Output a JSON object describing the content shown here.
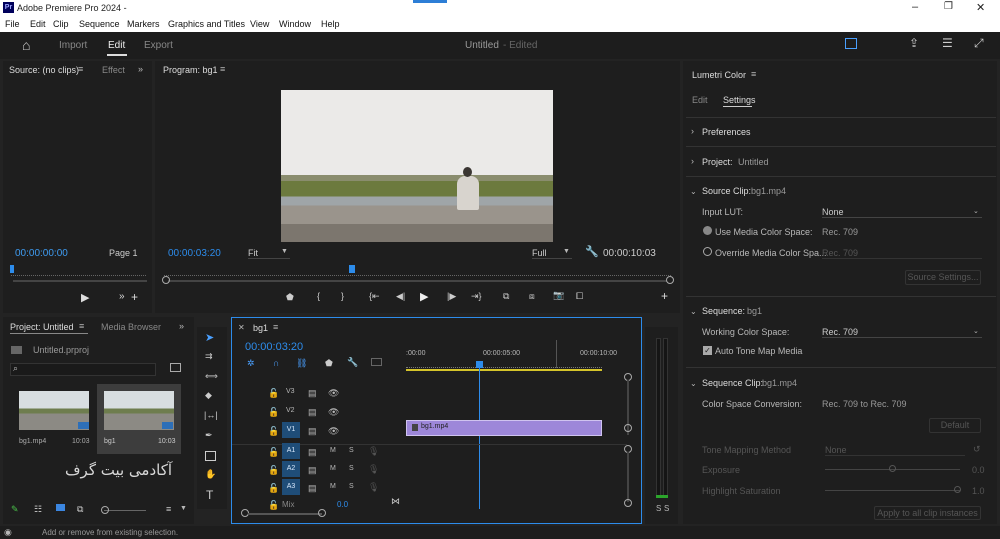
{
  "app": {
    "title": "Adobe Premiere Pro 2024 -",
    "logo": "Pr"
  },
  "menu": [
    "File",
    "Edit",
    "Clip",
    "Sequence",
    "Markers",
    "Graphics and Titles",
    "View",
    "Window",
    "Help"
  ],
  "header": {
    "tabs": [
      "Import",
      "Edit",
      "Export"
    ],
    "doc_title": "Untitled",
    "doc_status": "- Edited"
  },
  "source": {
    "title": "Source: (no clips)",
    "effect_tab": "Effect",
    "timecode": "00:00:00:00",
    "page": "Page 1"
  },
  "program": {
    "title": "Program: bg1",
    "timecode": "00:00:03:20",
    "fit": "Fit",
    "quality": "Full",
    "duration": "00:00:10:03"
  },
  "project": {
    "title": "Project: Untitled",
    "media_browser": "Media Browser",
    "file": "Untitled.prproj",
    "items": [
      {
        "name": "bg1.mp4",
        "duration": "10:03"
      },
      {
        "name": "bg1",
        "duration": "10:03"
      }
    ],
    "watermark": "آکادمی بیت گرف"
  },
  "timeline": {
    "title": "bg1",
    "timecode": "00:00:03:20",
    "ruler": [
      ":00:00",
      "00:00:05:00",
      "00:00:10:00"
    ],
    "video_tracks": [
      "V3",
      "V2",
      "V1"
    ],
    "audio_tracks": [
      "A1",
      "A2",
      "A3"
    ],
    "clip": "bg1.mp4",
    "mix_label": "Mix",
    "mix_value": "0.0",
    "mute": "M",
    "solo": "S"
  },
  "meter": {
    "labels": [
      "S",
      "S"
    ]
  },
  "lumetri": {
    "title": "Lumetri Color",
    "tabs": [
      "Edit",
      "Settings"
    ],
    "preferences": "Preferences",
    "project_label": "Project:",
    "project_value": "Untitled",
    "source_clip_label": "Source Clip:",
    "source_clip_value": "bg1.mp4",
    "input_lut_label": "Input LUT:",
    "input_lut_value": "None",
    "use_media_cs": "Use Media Color Space:",
    "use_media_cs_value": "Rec. 709",
    "override_cs": "Override Media Color Spa...",
    "override_cs_value": "Rec. 709",
    "source_settings": "Source Settings...",
    "sequence_label": "Sequence:",
    "sequence_value": "bg1",
    "working_cs_label": "Working Color Space:",
    "working_cs_value": "Rec. 709",
    "auto_tone": "Auto Tone Map Media",
    "seq_clip_label": "Sequence Clip:",
    "seq_clip_value": "bg1.mp4",
    "conversion_label": "Color Space Conversion:",
    "conversion_value": "Rec. 709 to Rec. 709",
    "default_btn": "Default",
    "tone_method_label": "Tone Mapping Method",
    "tone_method_value": "None",
    "exposure_label": "Exposure",
    "exposure_value": "0.0",
    "highlight_label": "Highlight Saturation",
    "highlight_value": "1.0",
    "apply_btn": "Apply to all clip instances"
  },
  "status": {
    "text": "Add or remove from existing selection."
  }
}
